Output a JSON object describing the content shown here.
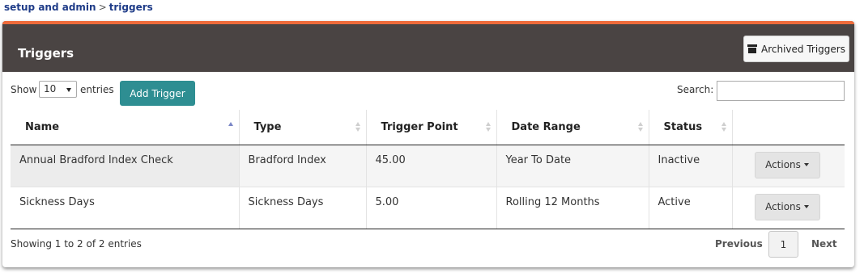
{
  "breadcrumb": {
    "parent": "setup and admin",
    "separator": ">",
    "current": "triggers"
  },
  "panel": {
    "title": "Triggers",
    "archived_button": "Archived Triggers",
    "archived_icon": "archive-icon",
    "accent_color": "#ee6b3b",
    "header_color": "#4a4443"
  },
  "controls": {
    "show_label": "Show",
    "entries_value": "10",
    "entries_label": "entries",
    "add_button": "Add Trigger",
    "add_button_color": "#2e8e92",
    "search_label": "Search:",
    "search_value": ""
  },
  "table": {
    "columns": [
      "Name",
      "Type",
      "Trigger Point",
      "Date Range",
      "Status"
    ],
    "rows": [
      {
        "name": "Annual Bradford Index Check",
        "type": "Bradford Index",
        "trigger_point": "45.00",
        "date_range": "Year To Date",
        "status": "Inactive",
        "action": "Actions"
      },
      {
        "name": "Sickness Days",
        "type": "Sickness Days",
        "trigger_point": "5.00",
        "date_range": "Rolling 12 Months",
        "status": "Active",
        "action": "Actions"
      }
    ]
  },
  "footer": {
    "info": "Showing 1 to 2 of 2 entries",
    "previous": "Previous",
    "current_page": "1",
    "next": "Next"
  }
}
